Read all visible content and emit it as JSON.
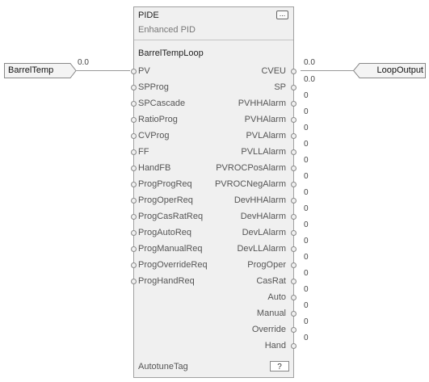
{
  "block": {
    "type": "PIDE",
    "description": "Enhanced PID",
    "menu_button": "...",
    "tag": "BarrelTempLoop",
    "footer_label": "AutotuneTag",
    "footer_value": "?"
  },
  "inputs": [
    "PV",
    "SPProg",
    "SPCascade",
    "RatioProg",
    "CVProg",
    "FF",
    "HandFB",
    "ProgProgReq",
    "ProgOperReq",
    "ProgCasRatReq",
    "ProgAutoReq",
    "ProgManualReq",
    "ProgOverrideReq",
    "ProgHandReq"
  ],
  "outputs": [
    "CVEU",
    "SP",
    "PVHHAlarm",
    "PVHAlarm",
    "PVLAlarm",
    "PVLLAlarm",
    "PVROCPosAlarm",
    "PVROCNegAlarm",
    "DevHHAlarm",
    "DevHAlarm",
    "DevLAlarm",
    "DevLLAlarm",
    "ProgOper",
    "CasRat",
    "Auto",
    "Manual",
    "Override",
    "Hand"
  ],
  "output_values": [
    "0.0",
    "0.0",
    "0",
    "0",
    "0",
    "0",
    "0",
    "0",
    "0",
    "0",
    "0",
    "0",
    "0",
    "0",
    "0",
    "0",
    "0",
    "0"
  ],
  "input_ref": {
    "name": "BarrelTemp",
    "value": "0.0"
  },
  "output_ref": {
    "name": "LoopOutput",
    "value": "0.0"
  }
}
